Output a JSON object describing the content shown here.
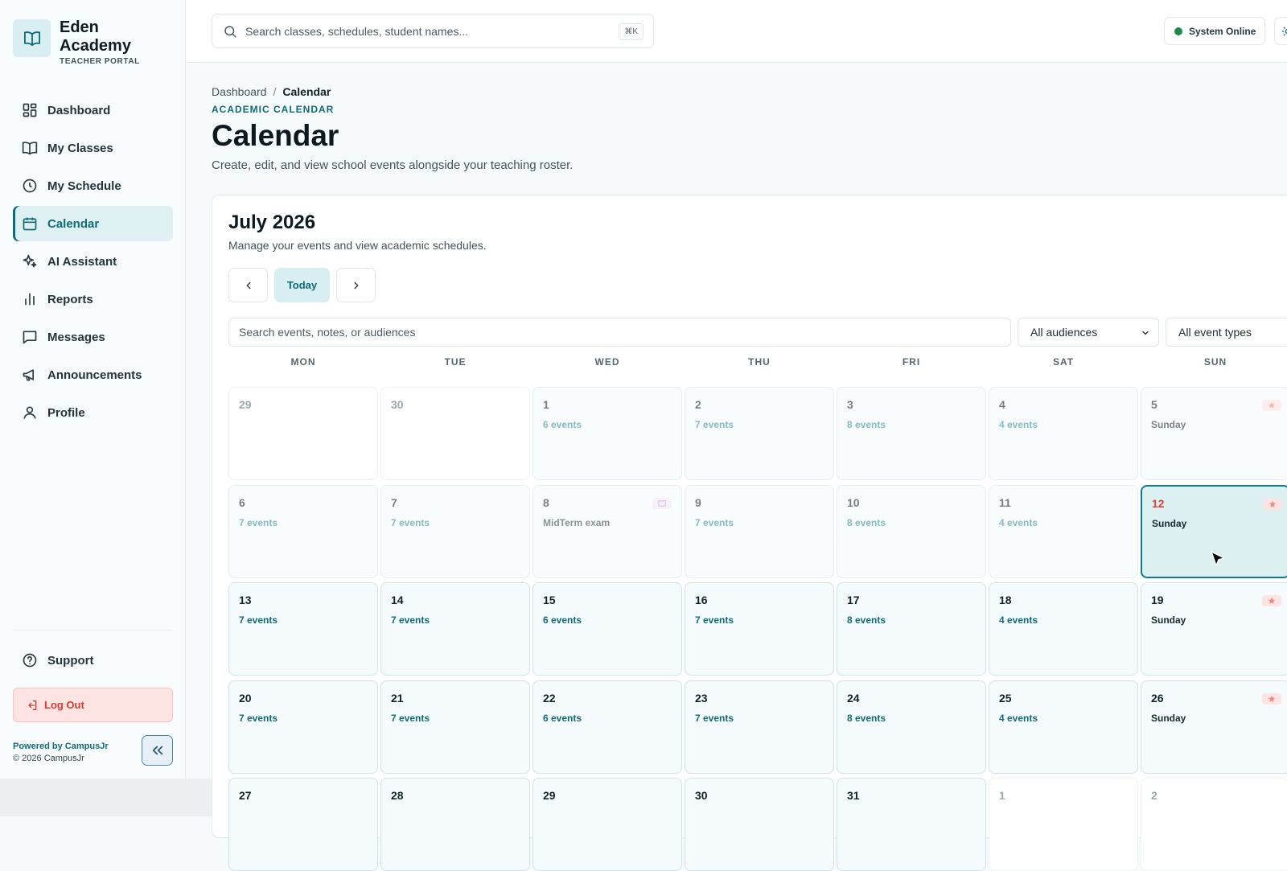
{
  "brand": {
    "name_line1": "Eden",
    "name_line2": "Academy",
    "subtitle": "TEACHER PORTAL",
    "logo_icon": "open-book-icon"
  },
  "nav": {
    "items": [
      {
        "label": "Dashboard",
        "icon": "grid-icon",
        "active": false
      },
      {
        "label": "My Classes",
        "icon": "book-icon",
        "active": false
      },
      {
        "label": "My Schedule",
        "icon": "clock-icon",
        "active": false
      },
      {
        "label": "Calendar",
        "icon": "calendar-icon",
        "active": true
      },
      {
        "label": "AI Assistant",
        "icon": "sparkles-icon",
        "active": false
      },
      {
        "label": "Reports",
        "icon": "bar-chart-icon",
        "active": false
      },
      {
        "label": "Messages",
        "icon": "message-icon",
        "active": false
      },
      {
        "label": "Announcements",
        "icon": "megaphone-icon",
        "active": false
      },
      {
        "label": "Profile",
        "icon": "user-icon",
        "active": false
      }
    ],
    "support": "Support",
    "logout": "Log Out"
  },
  "footer": {
    "powered": "Powered by CampusJr",
    "copyright": "© 2026 CampusJr"
  },
  "topbar": {
    "search_placeholder": "Search classes, schedules, student names...",
    "shortcut": "⌘K",
    "status": "System Online",
    "status_color": "#1f8a4c"
  },
  "header": {
    "breadcrumb": [
      "Dashboard",
      "/",
      "Calendar"
    ],
    "eyebrow": "ACADEMIC CALENDAR",
    "title": "Calendar",
    "subtitle": "Create, edit, and view school events alongside your teaching roster."
  },
  "calendar": {
    "month": "July 2026",
    "subtitle": "Manage your events and view academic schedules.",
    "today_label": "Today",
    "search_placeholder": "Search events, notes, or audiences",
    "audience_filter": "All audiences",
    "type_filter": "All event types",
    "weekdays": [
      "MON",
      "TUE",
      "WED",
      "THU",
      "FRI",
      "SAT",
      "SUN"
    ],
    "weeks": [
      [
        {
          "day": "29",
          "info": "",
          "kind": "other"
        },
        {
          "day": "30",
          "info": "",
          "kind": "other"
        },
        {
          "day": "1",
          "info": "6 events",
          "kind": "past"
        },
        {
          "day": "2",
          "info": "7 events",
          "kind": "past"
        },
        {
          "day": "3",
          "info": "8 events",
          "kind": "past"
        },
        {
          "day": "4",
          "info": "4 events",
          "kind": "past"
        },
        {
          "day": "5",
          "info": "Sunday",
          "kind": "past sunday",
          "tag": "red"
        }
      ],
      [
        {
          "day": "6",
          "info": "7 events",
          "kind": "past"
        },
        {
          "day": "7",
          "info": "7 events",
          "kind": "past"
        },
        {
          "day": "8",
          "info": "MidTerm exam",
          "kind": "past mid",
          "tag": "purple"
        },
        {
          "day": "9",
          "info": "7 events",
          "kind": "past"
        },
        {
          "day": "10",
          "info": "8 events",
          "kind": "past"
        },
        {
          "day": "11",
          "info": "4 events",
          "kind": "past"
        },
        {
          "day": "12",
          "info": "Sunday",
          "kind": "today-cell sunday",
          "tag": "red"
        }
      ],
      [
        {
          "day": "13",
          "info": "7 events",
          "kind": ""
        },
        {
          "day": "14",
          "info": "7 events",
          "kind": ""
        },
        {
          "day": "15",
          "info": "6 events",
          "kind": ""
        },
        {
          "day": "16",
          "info": "7 events",
          "kind": ""
        },
        {
          "day": "17",
          "info": "8 events",
          "kind": ""
        },
        {
          "day": "18",
          "info": "4 events",
          "kind": ""
        },
        {
          "day": "19",
          "info": "Sunday",
          "kind": "sunday",
          "tag": "red"
        }
      ],
      [
        {
          "day": "20",
          "info": "7 events",
          "kind": ""
        },
        {
          "day": "21",
          "info": "7 events",
          "kind": ""
        },
        {
          "day": "22",
          "info": "6 events",
          "kind": ""
        },
        {
          "day": "23",
          "info": "7 events",
          "kind": ""
        },
        {
          "day": "24",
          "info": "8 events",
          "kind": ""
        },
        {
          "day": "25",
          "info": "4 events",
          "kind": ""
        },
        {
          "day": "26",
          "info": "Sunday",
          "kind": "sunday",
          "tag": "red"
        }
      ],
      [
        {
          "day": "27",
          "info": "",
          "kind": ""
        },
        {
          "day": "28",
          "info": "",
          "kind": ""
        },
        {
          "day": "29",
          "info": "",
          "kind": ""
        },
        {
          "day": "30",
          "info": "",
          "kind": ""
        },
        {
          "day": "31",
          "info": "",
          "kind": ""
        },
        {
          "day": "1",
          "info": "",
          "kind": "other"
        },
        {
          "day": "2",
          "info": "",
          "kind": "other"
        }
      ]
    ]
  },
  "colors": {
    "accent": "#0f6b76",
    "danger": "#e03b34"
  }
}
